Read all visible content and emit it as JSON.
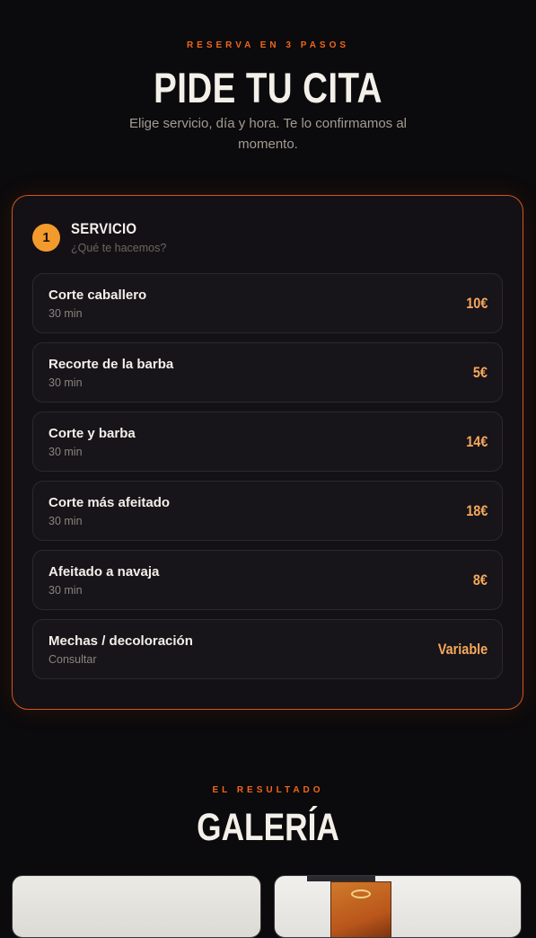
{
  "booking": {
    "eyebrow": "RESERVA EN 3 PASOS",
    "title": "PIDE TU CITA",
    "subtitle": "Elige servicio, día y hora. Te lo confirmamos al momento.",
    "step": {
      "number": "1",
      "title": "SERVICIO",
      "subtitle": "¿Qué te hacemos?"
    },
    "services": [
      {
        "name": "Corte caballero",
        "meta": "30 min",
        "price": "10€"
      },
      {
        "name": "Recorte de la barba",
        "meta": "30 min",
        "price": "5€"
      },
      {
        "name": "Corte y barba",
        "meta": "30 min",
        "price": "14€"
      },
      {
        "name": "Corte más afeitado",
        "meta": "30 min",
        "price": "18€"
      },
      {
        "name": "Afeitado a navaja",
        "meta": "30 min",
        "price": "8€"
      },
      {
        "name": "Mechas / decoloración",
        "meta": "Consultar",
        "price": "Variable"
      }
    ]
  },
  "gallery": {
    "eyebrow": "EL RESULTADO",
    "title": "GALERÍA"
  },
  "colors": {
    "background": "#0b0a0c",
    "accent": "#f0661b",
    "price": "#f6a85a",
    "card_border": "#d4561a"
  }
}
